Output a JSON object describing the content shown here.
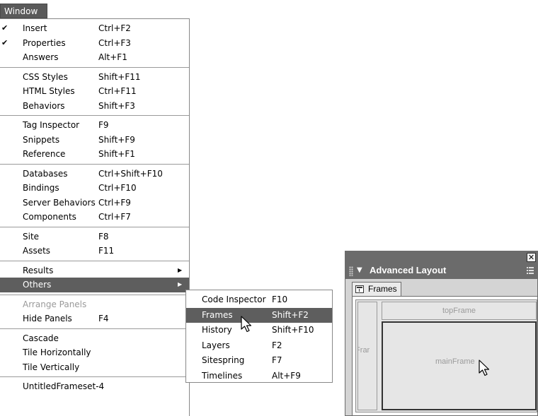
{
  "menu": {
    "title": "Window",
    "groups": [
      [
        {
          "check": "✔",
          "label": "Insert",
          "shortcut": "Ctrl+F2"
        },
        {
          "check": "✔",
          "label": "Properties",
          "shortcut": "Ctrl+F3"
        },
        {
          "check": "",
          "label": "Answers",
          "shortcut": "Alt+F1"
        }
      ],
      [
        {
          "label": "CSS Styles",
          "shortcut": "Shift+F11"
        },
        {
          "label": "HTML Styles",
          "shortcut": "Ctrl+F11"
        },
        {
          "label": "Behaviors",
          "shortcut": "Shift+F3"
        }
      ],
      [
        {
          "label": "Tag Inspector",
          "shortcut": "F9"
        },
        {
          "label": "Snippets",
          "shortcut": "Shift+F9"
        },
        {
          "label": "Reference",
          "shortcut": "Shift+F1"
        }
      ],
      [
        {
          "label": "Databases",
          "shortcut": "Ctrl+Shift+F10"
        },
        {
          "label": "Bindings",
          "shortcut": "Ctrl+F10"
        },
        {
          "label": "Server Behaviors",
          "shortcut": "Ctrl+F9"
        },
        {
          "label": "Components",
          "shortcut": "Ctrl+F7"
        }
      ],
      [
        {
          "label": "Site",
          "shortcut": "F8"
        },
        {
          "label": "Assets",
          "shortcut": "F11"
        }
      ],
      [
        {
          "label": "Results",
          "arrow": "▶"
        },
        {
          "label": "Others",
          "arrow": "▶"
        }
      ],
      [
        {
          "label": "Arrange Panels"
        },
        {
          "label": "Hide Panels",
          "shortcut": "F4"
        }
      ],
      [
        {
          "label": "Cascade"
        },
        {
          "label": "Tile Horizontally"
        },
        {
          "label": "Tile Vertically"
        }
      ],
      [
        {
          "label": "UntitledFrameset-4"
        }
      ]
    ]
  },
  "submenu": {
    "items": [
      {
        "label": "Code Inspector",
        "shortcut": "F10"
      },
      {
        "label": "Frames",
        "shortcut": "Shift+F2"
      },
      {
        "label": "History",
        "shortcut": "Shift+F10"
      },
      {
        "label": "Layers",
        "shortcut": "F2"
      },
      {
        "label": "Sitespring",
        "shortcut": "F7"
      },
      {
        "label": "Timelines",
        "shortcut": "Alt+F9"
      }
    ]
  },
  "panel": {
    "close_glyph": "✕",
    "collapse_glyph": "▼",
    "title": "Advanced Layout",
    "tab_label": "Frames",
    "frames": {
      "left": "tFrar",
      "top": "topFrame",
      "main": "mainFrame"
    }
  },
  "colors": {
    "highlight": "#5e5e5e",
    "menubar": "#5a5a5a",
    "panel_header": "#6b6b6b",
    "disabled_text": "#9a9a9a"
  }
}
